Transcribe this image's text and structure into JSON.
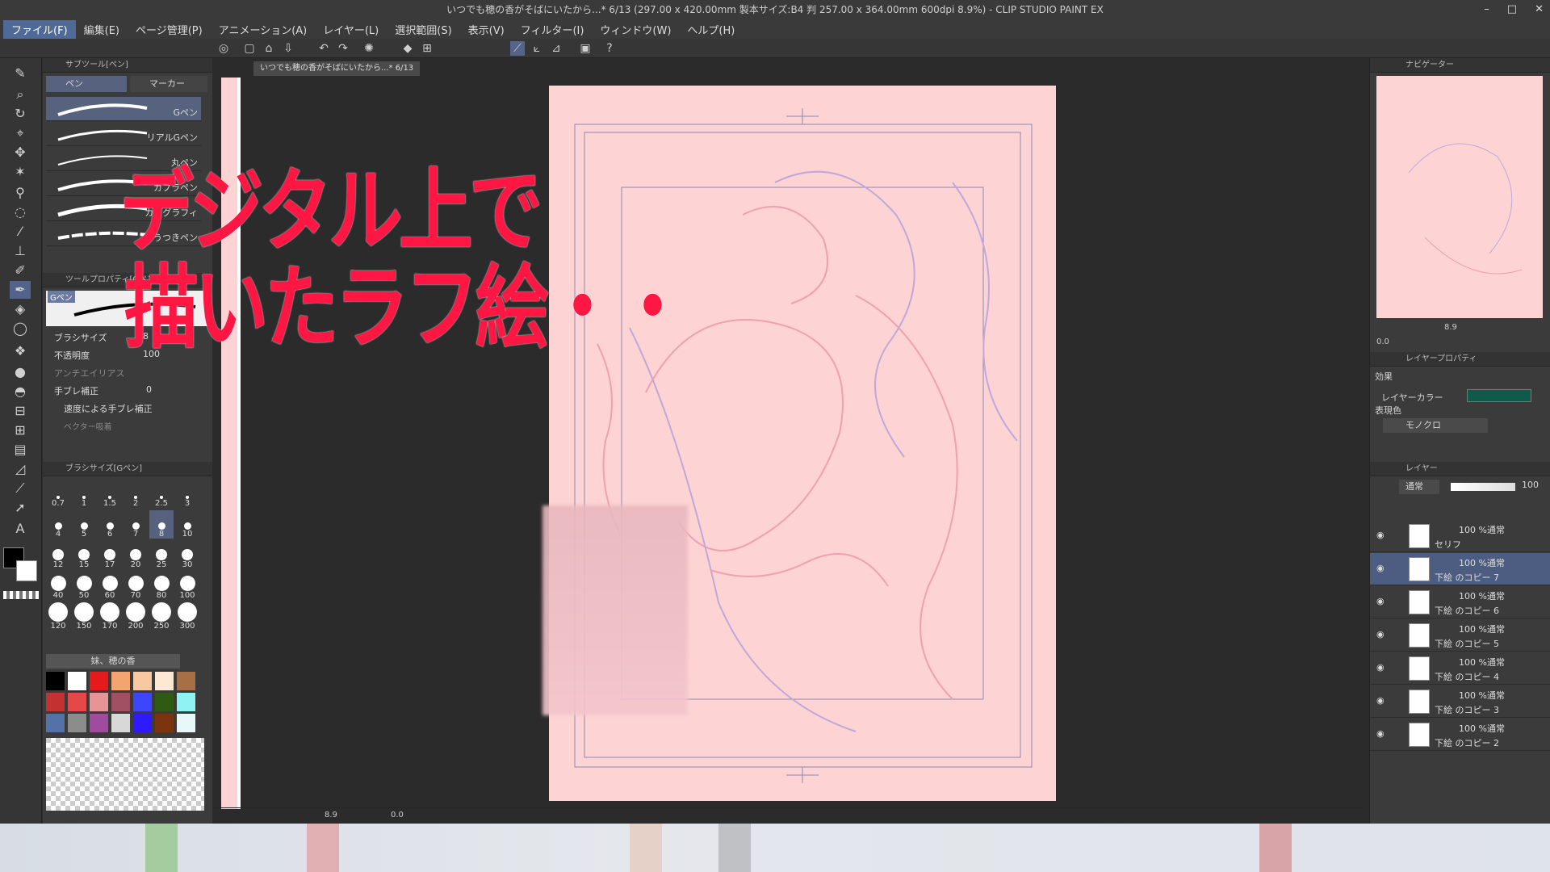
{
  "window": {
    "title": "いつでも穂の香がそばにいたから...* 6/13 (297.00 x 420.00mm 製本サイズ:B4 判 257.00 x 364.00mm 600dpi 8.9%) - CLIP STUDIO PAINT EX",
    "controls": [
      "–",
      "□",
      "✕"
    ]
  },
  "menu": [
    "ファイル(F)",
    "編集(E)",
    "ページ管理(P)",
    "アニメーション(A)",
    "レイヤー(L)",
    "選択範囲(S)",
    "表示(V)",
    "フィルター(I)",
    "ウィンドウ(W)",
    "ヘルプ(H)"
  ],
  "document_tab": "いつでも穂の香がそばにいたから...* 6/13",
  "subtool": {
    "panel_title": "サブツール[ペン]",
    "tabs": [
      "ペン",
      "マーカー"
    ],
    "brushes": [
      "Gペン",
      "リアルGペン",
      "丸ペン",
      "カブラペン",
      "カリグラフィ",
      "うつきペン"
    ]
  },
  "tool_property": {
    "panel_title": "ツールプロパティ[Gペン]",
    "preview_label": "Gペン",
    "rows": [
      {
        "label": "ブラシサイズ",
        "value": "8"
      },
      {
        "label": "不透明度",
        "value": "100"
      },
      {
        "label": "アンチエイリアス",
        "value": ""
      },
      {
        "label": "手ブレ補正",
        "value": "0"
      },
      {
        "label": "速度による手ブレ補正",
        "value": ""
      },
      {
        "label": "ベクター吸着",
        "value": ""
      }
    ]
  },
  "brush_size": {
    "panel_title": "ブラシサイズ[Gペン]",
    "sizes": [
      "0.7",
      "1",
      "1.5",
      "2",
      "2.5",
      "3",
      "4",
      "5",
      "6",
      "7",
      "8",
      "10",
      "12",
      "15",
      "17",
      "20",
      "25",
      "30",
      "40",
      "50",
      "60",
      "70",
      "80",
      "100",
      "120",
      "150",
      "170",
      "200",
      "250",
      "300"
    ],
    "selected": "8"
  },
  "color_set": {
    "name": "妹、穂の香",
    "colors": [
      "#000000",
      "#ffffff",
      "#e51b1b",
      "#f4a46e",
      "#f8c9a0",
      "#fde8d6",
      "#a86e46",
      "#c43131",
      "#e44848",
      "#e79499",
      "#a05060",
      "#3c46ff",
      "#2e5a12",
      "#8ff3f3",
      "#5472a8",
      "#8c8c8c",
      "#a04aa0",
      "#d8d8d8",
      "#2f1aff",
      "#7a3410",
      "#e8f8f8"
    ]
  },
  "overlay_text": {
    "line1": "デジタル上で",
    "line2": "描いたラフ絵・・"
  },
  "status_bar": {
    "zoom": "8.9",
    "angle": "0.0"
  },
  "navigator": {
    "title": "ナビゲーター",
    "zoom": "8.9",
    "angle": "0.0"
  },
  "layer_property": {
    "title": "レイヤープロパティ",
    "effect_label": "効果",
    "layer_color_label": "レイヤーカラー",
    "expression_color_label": "表現色",
    "expression_color_value": "モノクロ"
  },
  "layers": {
    "title": "レイヤー",
    "blend_mode": "通常",
    "opacity": "100",
    "items": [
      {
        "mode": "100 %通常",
        "name": "セリフ"
      },
      {
        "mode": "100 %通常",
        "name": "下絵 のコピー 7"
      },
      {
        "mode": "100 %通常",
        "name": "下絵 のコピー 6"
      },
      {
        "mode": "100 %通常",
        "name": "下絵 のコピー 5"
      },
      {
        "mode": "100 %通常",
        "name": "下絵 のコピー 4"
      },
      {
        "mode": "100 %通常",
        "name": "下絵 のコピー 3"
      },
      {
        "mode": "100 %通常",
        "name": "下絵 のコピー 2"
      }
    ],
    "selected_index": 1
  },
  "colors": {
    "accent": "#4f6a96",
    "page": "#fdd3d3",
    "overlay": "#ff1744",
    "layer_color": "#0f5a4a"
  }
}
